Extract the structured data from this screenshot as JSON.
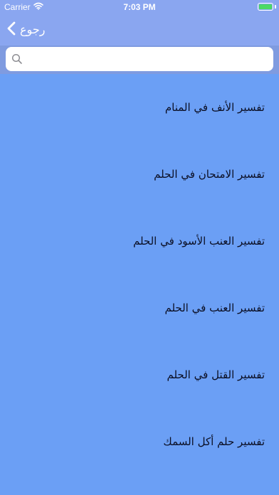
{
  "status_bar": {
    "carrier": "Carrier",
    "time": "7:03 PM",
    "battery_color": "#4cd964"
  },
  "nav": {
    "back_label": "رجوع",
    "back_icon": "chevron-left-icon"
  },
  "search": {
    "value": "",
    "placeholder": "",
    "icon": "search-icon"
  },
  "colors": {
    "background": "#6b9ff5",
    "nav_bar": "#8aa6f0",
    "search_bar": "#7f9be0"
  },
  "list": {
    "items": [
      {
        "label": "تفسير الأنف في المنام"
      },
      {
        "label": "تفسير الامتحان في الحلم"
      },
      {
        "label": "تفسير العنب الأسود في الحلم"
      },
      {
        "label": "تفسير العنب في الحلم"
      },
      {
        "label": "تفسير القتل في الحلم"
      },
      {
        "label": "تفسير حلم أكل السمك"
      }
    ]
  }
}
